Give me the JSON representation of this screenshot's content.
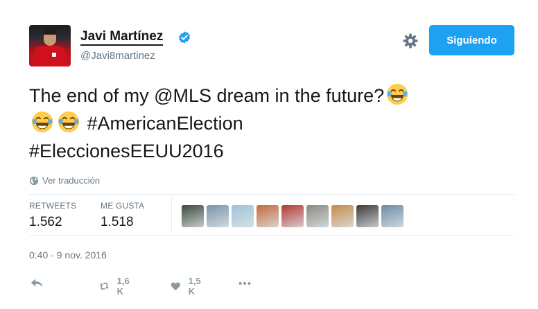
{
  "header": {
    "display_name": "Javi Martínez",
    "handle": "@Javi8martinez",
    "follow_button_label": "Siguiendo",
    "verified": true
  },
  "tweet": {
    "line1": "The end of my @MLS dream in the future?",
    "line2_text": "#AmericanElection",
    "line3": "#EleccionesEEUU2016",
    "emojis": [
      "face-with-tears-of-joy",
      "face-with-tears-of-joy",
      "face-with-tears-of-joy"
    ]
  },
  "translate_label": "Ver traducción",
  "stats": {
    "retweets_label": "RETWEETS",
    "retweets_value": "1.562",
    "likes_label": "ME GUSTA",
    "likes_value": "1.518"
  },
  "liker_avatars": [
    {
      "name": "liker-avatar",
      "color": "#3b4a3a"
    },
    {
      "name": "liker-avatar",
      "color": "#7c95a8"
    },
    {
      "name": "liker-avatar",
      "color": "#9ec4d6"
    },
    {
      "name": "liker-avatar",
      "color": "#c46b3a"
    },
    {
      "name": "liker-avatar",
      "color": "#b23a36"
    },
    {
      "name": "liker-avatar",
      "color": "#8a8a7e"
    },
    {
      "name": "liker-avatar",
      "color": "#c48a4a"
    },
    {
      "name": "liker-avatar",
      "color": "#3e3a38"
    },
    {
      "name": "liker-avatar",
      "color": "#6e8aa6"
    }
  ],
  "timestamp": "0:40 - 9 nov. 2016",
  "actions": {
    "retweet_count": "1,6 K",
    "like_count": "1,5 K"
  },
  "colors": {
    "accent": "#1da1f2",
    "secondary_text": "#657786",
    "icon_gray": "#8899a6"
  }
}
